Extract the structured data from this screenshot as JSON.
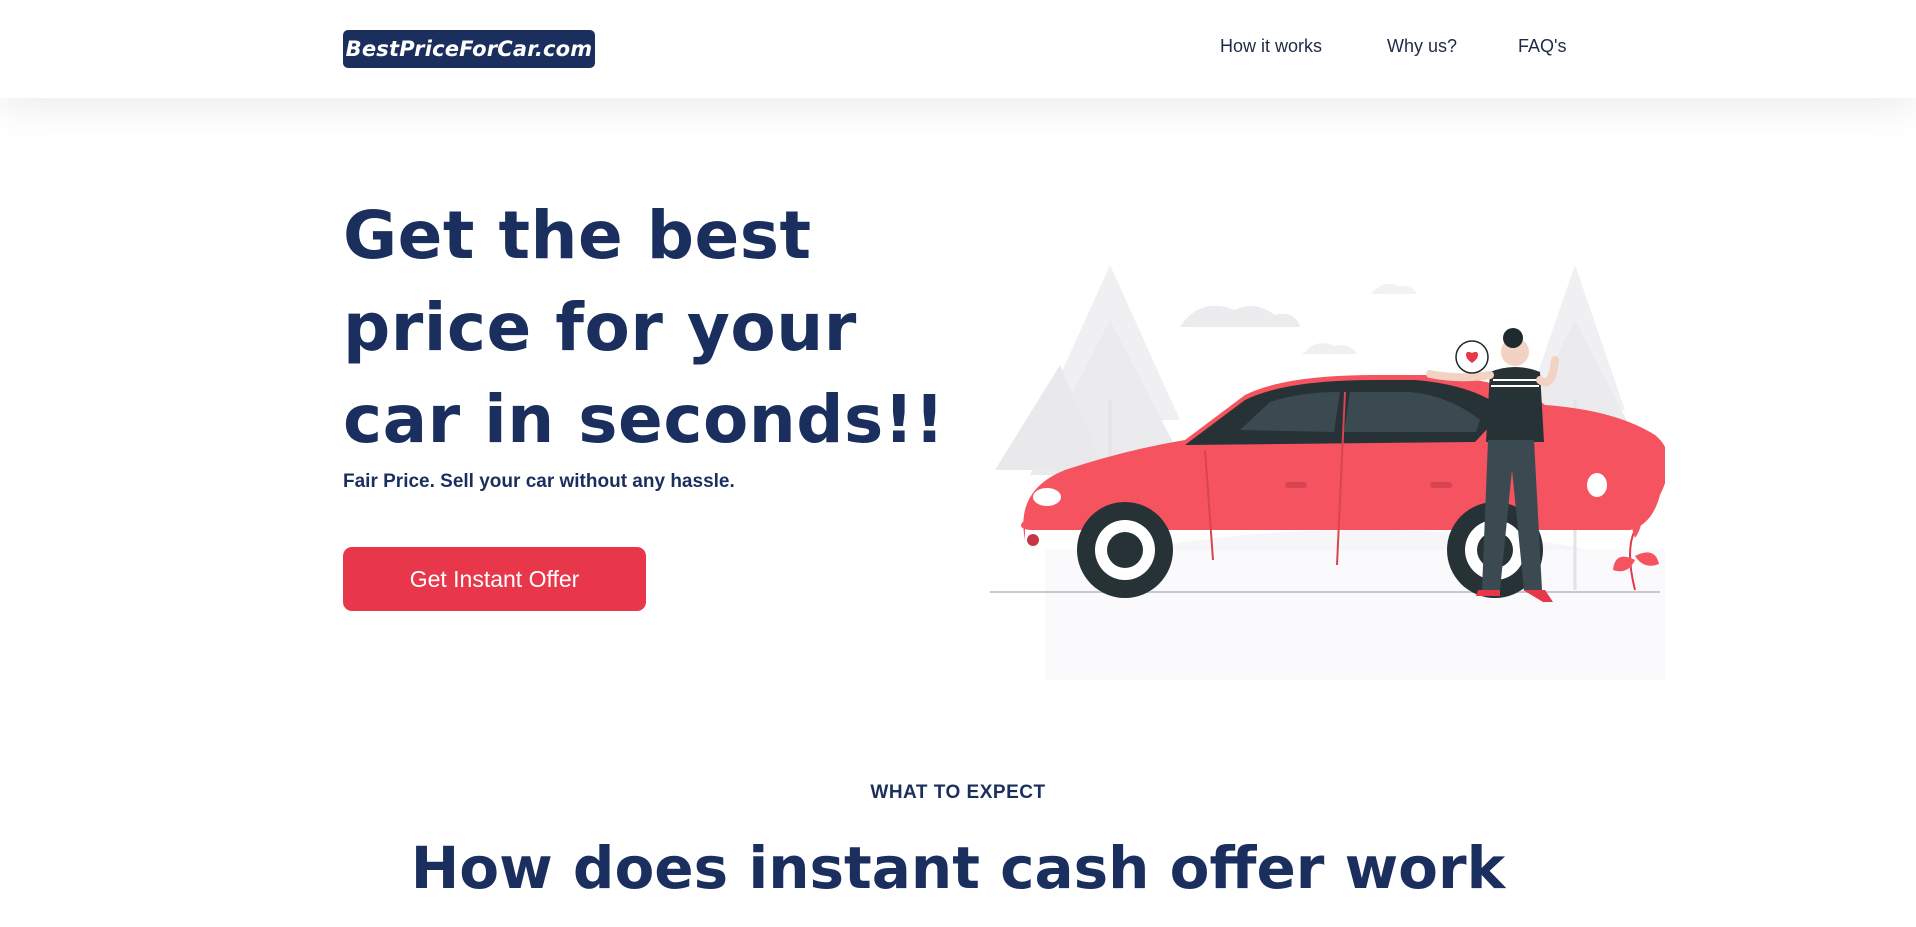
{
  "brand": {
    "logo_text": "BestPriceForCar.com",
    "color": "#1b2f5e"
  },
  "nav": {
    "links": [
      "How it works",
      "Why us?",
      "FAQ's"
    ]
  },
  "hero": {
    "title": "Get the best price for your car in seconds!!",
    "subtitle": "Fair Price. Sell your car without any hassle.",
    "cta_label": "Get Instant Offer",
    "cta_color": "#e8374a",
    "illustration": "man-with-red-car-illustration"
  },
  "section": {
    "eyebrow": "WHAT TO EXPECT",
    "title": "How does instant cash offer work"
  }
}
